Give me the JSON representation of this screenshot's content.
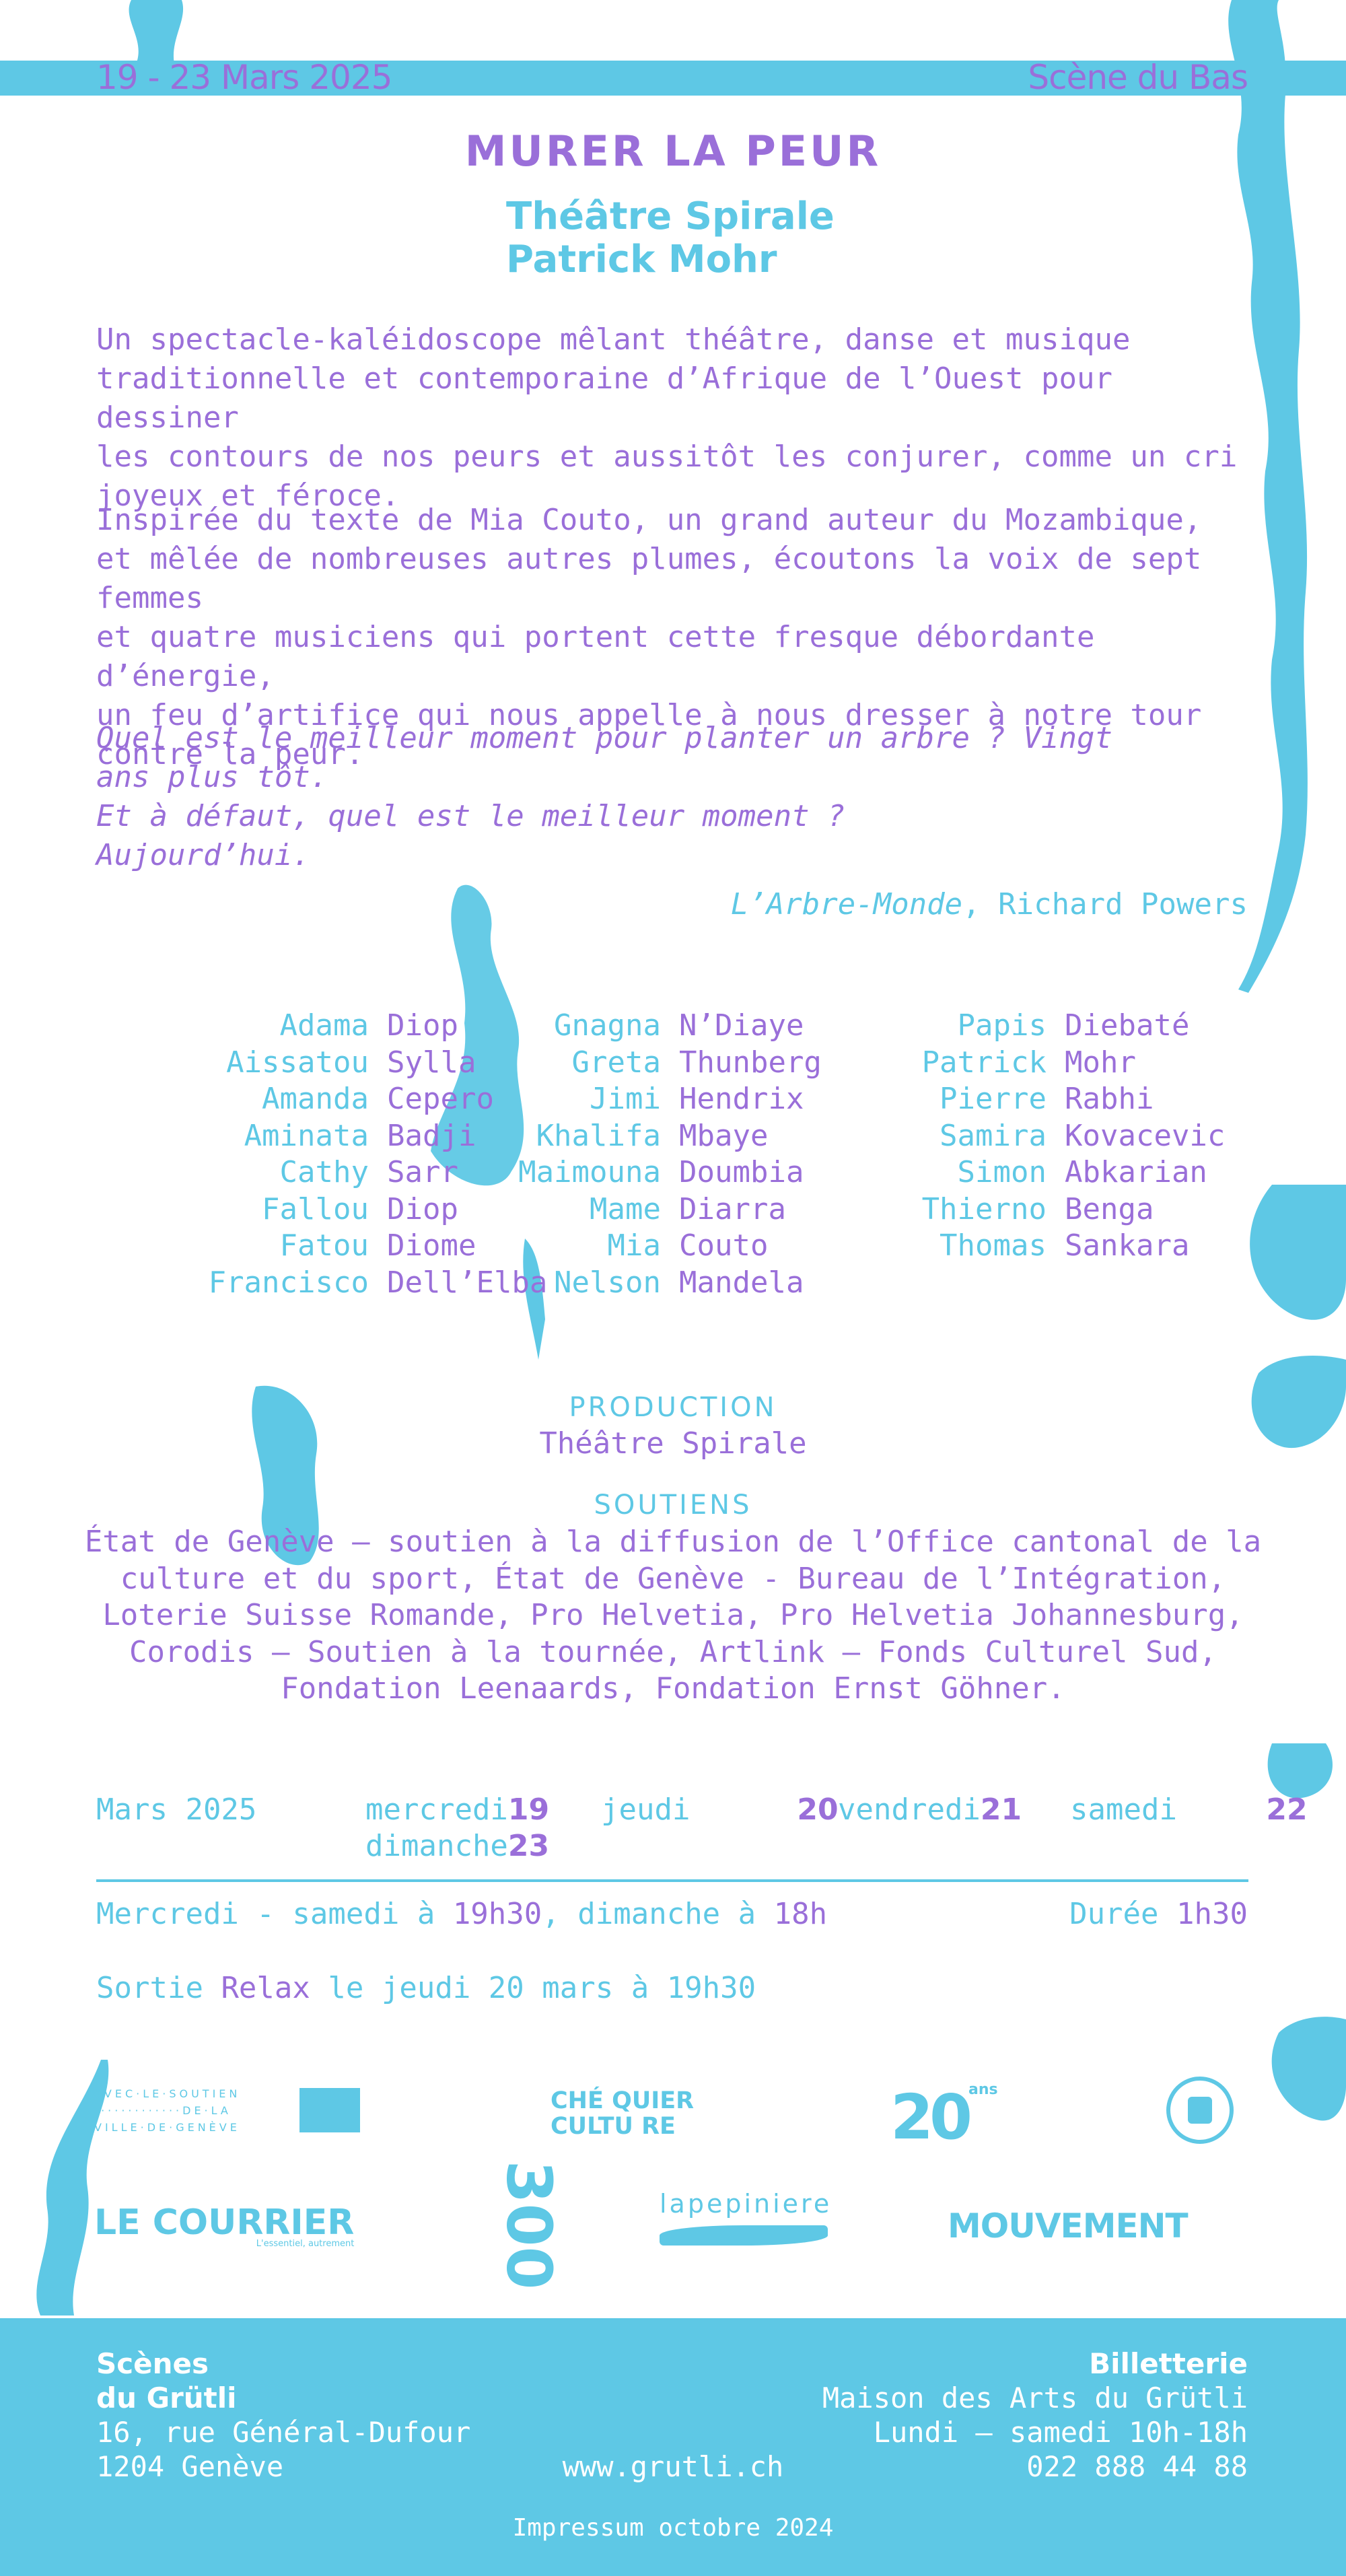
{
  "colors": {
    "accent_blue": "#5ec8e5",
    "accent_purple": "#9a6fd9",
    "background": "#ffffff"
  },
  "header": {
    "dates": "19 - 23 Mars 2025",
    "venue": "Scène du Bas"
  },
  "title": "MURER LA PEUR",
  "company": {
    "line1": "Théâtre Spirale",
    "line2": "Patrick Mohr"
  },
  "description": {
    "para1": "Un spectacle-kaléidoscope mêlant théâtre, danse et musique\ntraditionnelle et contemporaine d’Afrique de l’Ouest pour dessiner\nles contours de nos peurs et aussitôt les conjurer, comme un cri\njoyeux et féroce.",
    "para2": " Inspirée du texte de Mia Couto, un grand auteur du Mozambique,\net mêlée de nombreuses autres plumes, écoutons la voix de sept femmes\net quatre musiciens qui portent cette fresque débordante d’énergie,\nun feu d’artifice qui nous appelle à nous dresser à notre tour\ncontre la peur.",
    "quote": "Quel est le meilleur moment pour planter un arbre ? Vingt\nans plus tôt.\nEt à défaut, quel est le meilleur moment ?\nAujourd’hui.",
    "citation_work": "L’Arbre-Monde",
    "citation_author": ", Richard Powers"
  },
  "names": {
    "col1": [
      {
        "first": "Adama",
        "last": "Diop"
      },
      {
        "first": "Aissatou",
        "last": "Sylla"
      },
      {
        "first": "Amanda",
        "last": "Cepero"
      },
      {
        "first": "Aminata",
        "last": "Badji"
      },
      {
        "first": "Cathy",
        "last": "Sarr"
      },
      {
        "first": "Fallou",
        "last": "Diop"
      },
      {
        "first": "Fatou",
        "last": "Diome"
      },
      {
        "first": "Francisco",
        "last": "Dell’Elba"
      }
    ],
    "col2": [
      {
        "first": "Gnagna",
        "last": "N’Diaye"
      },
      {
        "first": "Greta",
        "last": "Thunberg"
      },
      {
        "first": "Jimi",
        "last": "Hendrix"
      },
      {
        "first": "Khalifa",
        "last": "Mbaye"
      },
      {
        "first": "Maimouna",
        "last": "Doumbia"
      },
      {
        "first": "Mame",
        "last": "Diarra"
      },
      {
        "first": "Mia",
        "last": "Couto"
      },
      {
        "first": "Nelson",
        "last": "Mandela"
      }
    ],
    "col3": [
      {
        "first": "Papis",
        "last": "Diebaté"
      },
      {
        "first": "Patrick",
        "last": "Mohr"
      },
      {
        "first": "Pierre",
        "last": "Rabhi"
      },
      {
        "first": "Samira",
        "last": "Kovacevic"
      },
      {
        "first": "Simon",
        "last": "Abkarian"
      },
      {
        "first": "Thierno",
        "last": "Benga"
      },
      {
        "first": "Thomas",
        "last": "Sankara"
      }
    ]
  },
  "production": {
    "heading": "PRODUCTION",
    "text": "Théâtre Spirale"
  },
  "soutiens": {
    "heading": "SOUTIENS",
    "text": "État de Genève – soutien à la diffusion de l’Office cantonal de la culture et du sport, État de Genève - Bureau de l’Intégration, Loterie Suisse Romande, Pro Helvetia, Pro Helvetia Johannesburg, Corodis – Soutien à la tournée, Artlink – Fonds Culturel Sud, Fondation Leenaards, Fondation Ernst Göhner."
  },
  "schedule": {
    "month": "Mars 2025",
    "days": [
      {
        "day": "mercredi",
        "num": "19"
      },
      {
        "day": "jeudi",
        "num": "20"
      },
      {
        "day": "vendredi",
        "num": "21"
      },
      {
        "day": "samedi",
        "num": "22"
      },
      {
        "day": "dimanche",
        "num": "23"
      }
    ],
    "times_a": "Mercredi - samedi à ",
    "times_b": "19h30",
    "times_c": ", dimanche à ",
    "times_d": "18h",
    "duration_label": "Durée ",
    "duration_value": "1h30",
    "relax_a": "Sortie ",
    "relax_b": "Relax",
    "relax_c": " le jeudi 20 mars à 19h30"
  },
  "logos": {
    "ville_line1": "AVEC·LE·SOUTIEN",
    "ville_line2": "·············DE·LA",
    "ville_line3": "VILLE·DE·GENÈVE",
    "cheque_line1": "CHÉ  QUIER",
    "cheque_line2": "CULTU  RE",
    "twenty": "20",
    "twenty_ans": "ans",
    "courrier": "LE COURRIER",
    "courrier_tag": "L'essentiel, autrement",
    "trois_cent": "300",
    "pepiniere": "lapepiniere",
    "mouvement": "MOUVEMENT",
    "icons": [
      "ville-de-geneve-logo",
      "cheque-culture-logo",
      "20-ans-logo",
      "culture-inclusive-logo",
      "le-courrier-logo",
      "300-logo",
      "lapepiniere-logo",
      "mouvement-logo"
    ]
  },
  "footer": {
    "left_line1": "Scènes",
    "left_line2": "du Grütli",
    "left_line3": "16, rue Général-Dufour",
    "left_line4": "1204 Genève",
    "web": "www.grutli.ch",
    "right_line1": "Billetterie",
    "right_line2": "Maison des Arts du Grütli",
    "right_line3": "Lundi – samedi 10h-18h",
    "right_line4": "022 888 44 88",
    "impressum": "Impressum octobre 2024"
  }
}
